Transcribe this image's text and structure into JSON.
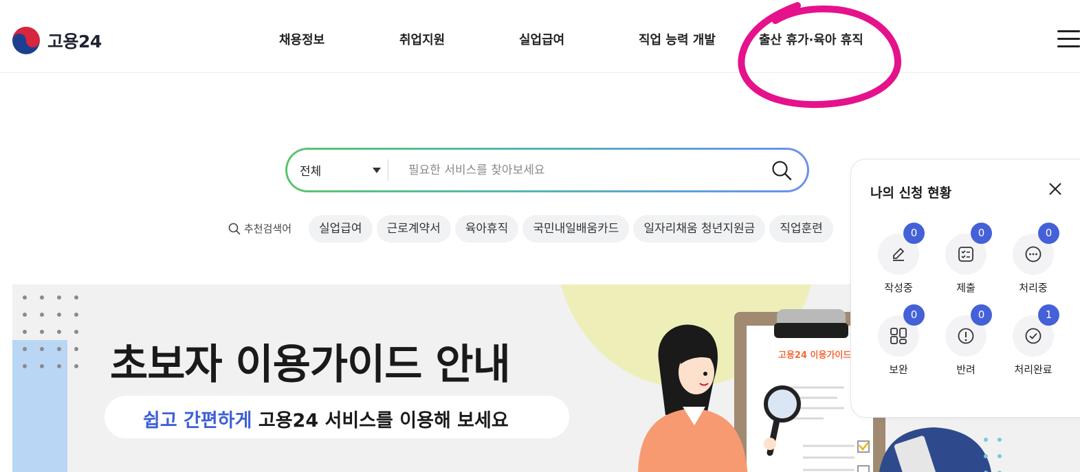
{
  "header": {
    "logo_text": "고용24",
    "nav": [
      "채용정보",
      "취업지원",
      "실업급여",
      "직업 능력 개발",
      "출산 휴가·육아 휴직"
    ]
  },
  "search": {
    "scope": "전체",
    "placeholder": "필요한 서비스를 찾아보세요"
  },
  "recommended": {
    "label": "추천검색어",
    "keywords": [
      "실업급여",
      "근로계약서",
      "육아휴직",
      "국민내일배움카드",
      "일자리채움 청년지원금",
      "직업훈련"
    ]
  },
  "banner": {
    "title": "초보자 이용가이드 안내",
    "subtitle_accent": "쉽고 간편하게",
    "subtitle_rest": " 고용24 서비스를 이용해 보세요",
    "clipboard_title": "고용24 이용가이드"
  },
  "status_panel": {
    "title": "나의 신청 현황",
    "items": [
      {
        "label": "작성중",
        "count": "0",
        "icon": "pencil-icon"
      },
      {
        "label": "제출",
        "count": "0",
        "icon": "checklist-icon"
      },
      {
        "label": "처리중",
        "count": "0",
        "icon": "ellipsis-icon"
      },
      {
        "label": "보완",
        "count": "0",
        "icon": "grid-icon"
      },
      {
        "label": "반려",
        "count": "0",
        "icon": "exclamation-icon"
      },
      {
        "label": "처리완료",
        "count": "1",
        "icon": "check-circle-icon"
      }
    ]
  },
  "colors": {
    "accent_blue": "#4461d8",
    "annotation_magenta": "#e5128c",
    "search_gradient_start": "#5ac46b",
    "search_gradient_end": "#6b8ff0"
  }
}
